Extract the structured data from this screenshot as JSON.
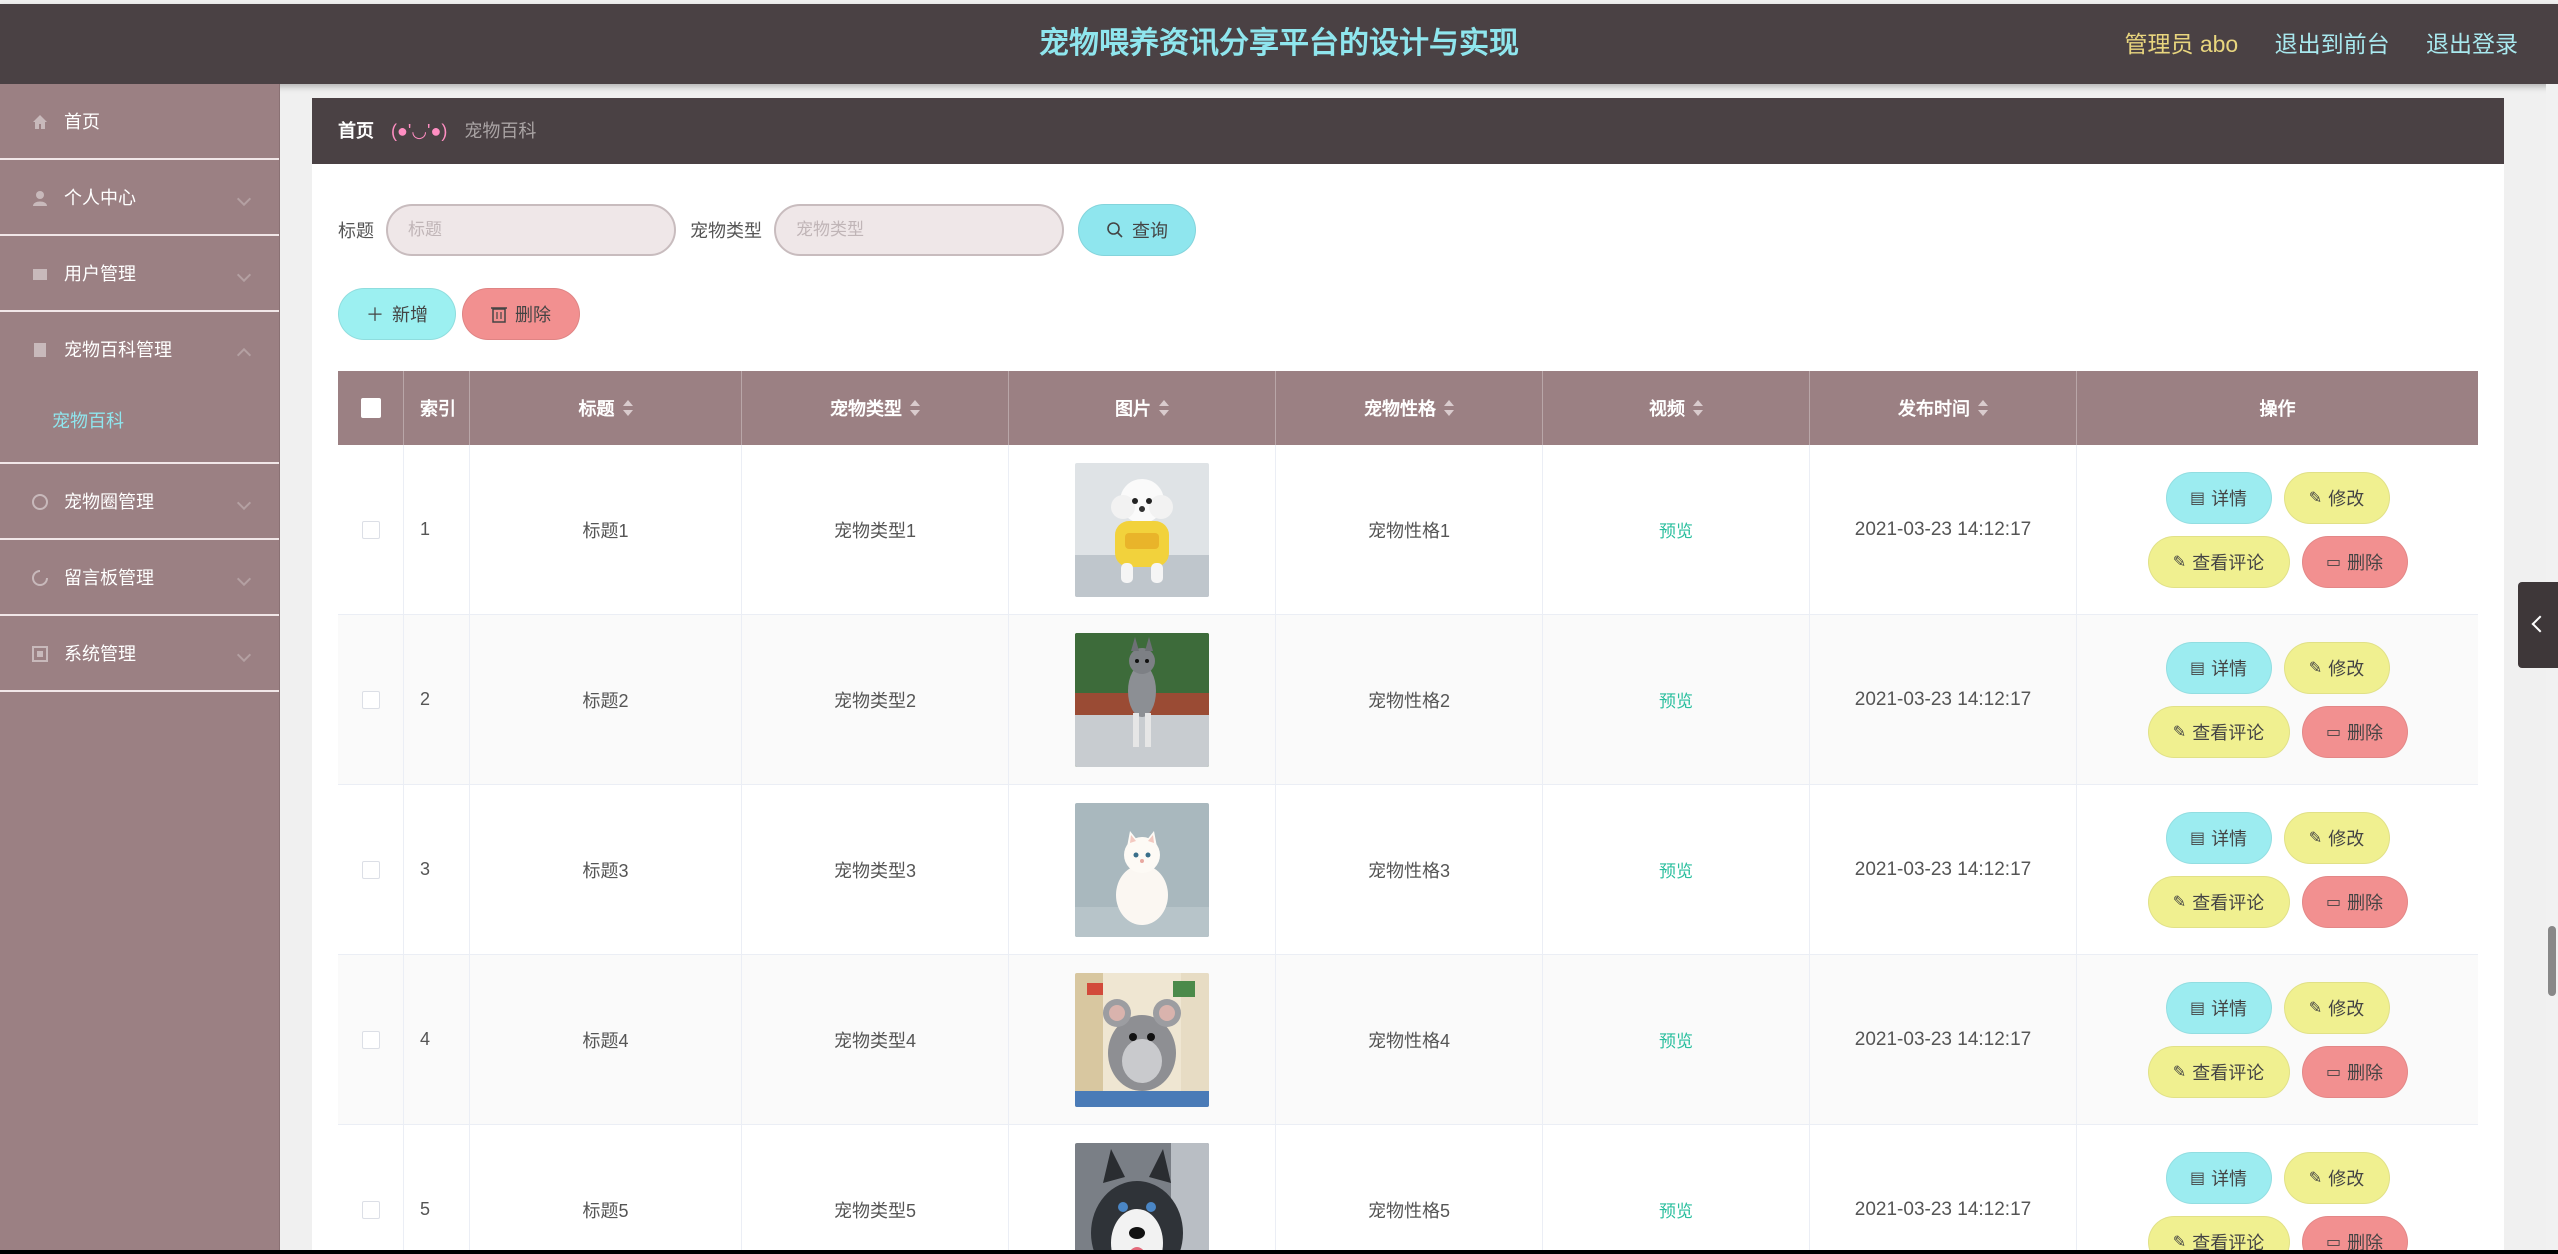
{
  "header": {
    "title": "宠物喂养资讯分享平台的设计与实现",
    "admin": "管理员 abo",
    "to_front": "退出到前台",
    "logout": "退出登录"
  },
  "sidebar": {
    "items": [
      {
        "label": "首页",
        "icon": "home-icon"
      },
      {
        "label": "个人中心",
        "icon": "user-icon"
      },
      {
        "label": "用户管理",
        "icon": "users-icon"
      },
      {
        "label": "宠物百科管理",
        "icon": "book-icon"
      },
      {
        "label": "宠物圈管理",
        "icon": "circle-icon"
      },
      {
        "label": "留言板管理",
        "icon": "message-icon"
      },
      {
        "label": "系统管理",
        "icon": "settings-icon"
      }
    ],
    "active_sub": "宠物百科"
  },
  "breadcrumb": {
    "home": "首页",
    "separator": "(●'◡'●)",
    "current": "宠物百科"
  },
  "search": {
    "title_label": "标题",
    "title_placeholder": "标题",
    "type_label": "宠物类型",
    "type_placeholder": "宠物类型",
    "search_button": "查询"
  },
  "actions": {
    "add": "新增",
    "delete": "删除"
  },
  "table": {
    "columns": [
      "索引",
      "标题",
      "宠物类型",
      "图片",
      "宠物性格",
      "视频",
      "发布时间",
      "操作"
    ],
    "rows": [
      {
        "index": "1",
        "title": "标题1",
        "type": "宠物类型1",
        "trait": "宠物性格1",
        "video": "预览",
        "time": "2021-03-23 14:12:17",
        "image": "white-poodle-in-yellow-coat"
      },
      {
        "index": "2",
        "title": "标题2",
        "type": "宠物类型2",
        "trait": "宠物性格2",
        "video": "预览",
        "time": "2021-03-23 14:12:17",
        "image": "grey-dog-jumping-on-grass"
      },
      {
        "index": "3",
        "title": "标题3",
        "type": "宠物类型3",
        "trait": "宠物性格3",
        "video": "预览",
        "time": "2021-03-23 14:12:17",
        "image": "white-cat-sitting"
      },
      {
        "index": "4",
        "title": "标题4",
        "type": "宠物类型4",
        "trait": "宠物性格4",
        "video": "预览",
        "time": "2021-03-23 14:12:17",
        "image": "grey-chinchilla"
      },
      {
        "index": "5",
        "title": "标题5",
        "type": "宠物类型5",
        "trait": "宠物性格5",
        "video": "预览",
        "time": "2021-03-23 14:12:17",
        "image": "husky-dog"
      }
    ],
    "ops": {
      "detail": "详情",
      "edit": "修改",
      "comment": "查看评论",
      "delete": "删除"
    }
  },
  "colors": {
    "header_bg": "#4a4144",
    "title": "#8fe6ee",
    "sidebar_bg": "#9b8083",
    "accent_cyan": "#8fe6ee",
    "accent_yellow": "#f0f090",
    "accent_red": "#f29090"
  }
}
